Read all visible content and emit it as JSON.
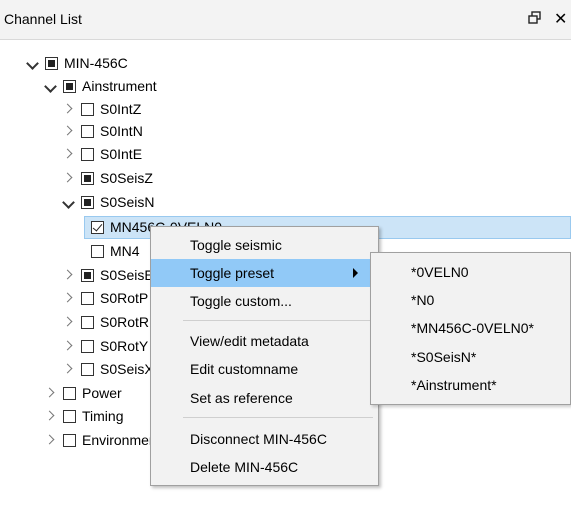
{
  "window": {
    "title": "Channel List",
    "float_icon": "float-window-icon",
    "close_glyph": "✕"
  },
  "tree": {
    "root": {
      "label": "MIN-456C",
      "state": "partial",
      "expanded": true
    },
    "ainstrument": {
      "label": "Ainstrument",
      "state": "partial",
      "expanded": true
    },
    "s0intz": {
      "label": "S0IntZ",
      "state": "unchecked"
    },
    "s0intn": {
      "label": "S0IntN",
      "state": "unchecked"
    },
    "s0inte": {
      "label": "S0IntE",
      "state": "unchecked"
    },
    "s0seisz": {
      "label": "S0SeisZ",
      "state": "partial"
    },
    "s0seisn": {
      "label": "S0SeisN",
      "state": "partial",
      "expanded": true
    },
    "mn4_a": {
      "label": "MN456C-0VELN0",
      "state": "checked"
    },
    "mn4_b": {
      "label": "MN4",
      "state": "unchecked"
    },
    "s0seise": {
      "label": "S0SeisE",
      "state": "partial"
    },
    "s0rotp": {
      "label": "S0RotP",
      "state": "unchecked"
    },
    "s0rotr": {
      "label": "S0RotR",
      "state": "unchecked"
    },
    "s0roty": {
      "label": "S0RotY",
      "state": "unchecked"
    },
    "s0seisx": {
      "label": "S0SeisX",
      "state": "unchecked"
    },
    "power": {
      "label": "Power",
      "state": "unchecked"
    },
    "timing": {
      "label": "Timing",
      "state": "unchecked"
    },
    "environment": {
      "label": "Environment",
      "state": "unchecked"
    }
  },
  "context_menu": {
    "toggle_seismic": "Toggle seismic",
    "toggle_preset": "Toggle preset",
    "toggle_custom": "Toggle custom...",
    "view_edit_metadata": "View/edit metadata",
    "edit_customname": "Edit customname",
    "set_as_reference": "Set as reference",
    "disconnect": "Disconnect MIN-456C",
    "delete": "Delete MIN-456C"
  },
  "preset_submenu": {
    "items": [
      "*0VELN0",
      "*N0",
      "*MN456C-0VELN0*",
      "*S0SeisN*",
      "*Ainstrument*"
    ]
  },
  "colors": {
    "selection_bg": "#cce4f7",
    "menu_highlight": "#91c9f7",
    "menu_bg": "#f2f2f2"
  }
}
